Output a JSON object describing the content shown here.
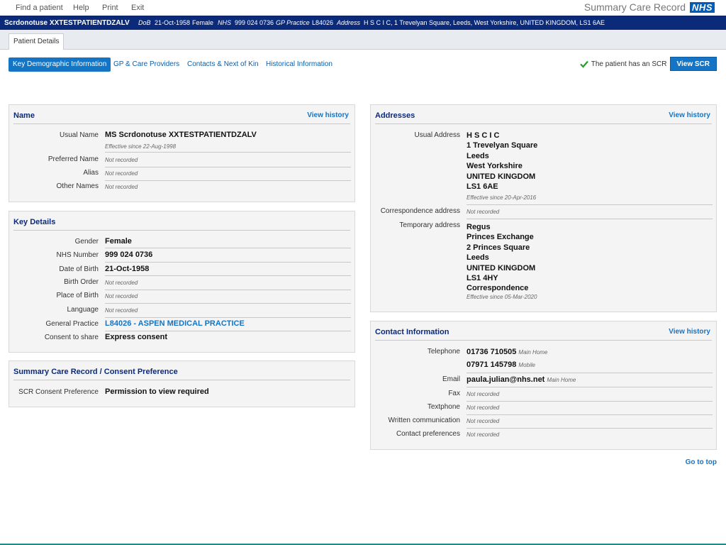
{
  "topnav": {
    "find_patient": "Find a patient",
    "help": "Help",
    "print": "Print",
    "exit": "Exit",
    "brand_title": "Summary Care Record",
    "nhs_logo": "NHS"
  },
  "banner": {
    "patient_name": "Scrdonotuse XXTESTPATIENTDZALV",
    "dob_label": "DoB",
    "dob": "21-Oct-1958",
    "gender": "Female",
    "nhs_label": "NHS",
    "nhs_number": "999 024 0736",
    "gp_label": "GP Practice",
    "gp_code": "L84026",
    "address_label": "Address",
    "address": "H S C I C, 1 Trevelyan Square, Leeds, West Yorkshire, UNITED KINGDOM, LS1 6AE"
  },
  "tabs": {
    "patient_details": "Patient Details"
  },
  "subnav": {
    "key_demographic": "Key Demographic Information",
    "gp_care": "GP & Care Providers",
    "contacts": "Contacts & Next of Kin",
    "historical": "Historical Information"
  },
  "scr": {
    "status_text": "The patient has an SCR",
    "view_button": "View SCR",
    "status_color": "#2a9a2a"
  },
  "name_panel": {
    "title": "Name",
    "view_history": "View history",
    "usual_name_label": "Usual Name",
    "usual_name": "MS Scrdonotuse XXTESTPATIENTDZALV",
    "usual_name_effective": "Effective since 22-Aug-1998",
    "preferred_name_label": "Preferred Name",
    "preferred_name": "Not recorded",
    "alias_label": "Alias",
    "alias": "Not recorded",
    "other_names_label": "Other Names",
    "other_names": "Not recorded"
  },
  "key_details": {
    "title": "Key Details",
    "gender_label": "Gender",
    "gender": "Female",
    "nhs_number_label": "NHS Number",
    "nhs_number": "999 024 0736",
    "dob_label": "Date of Birth",
    "dob": "21-Oct-1958",
    "birth_order_label": "Birth Order",
    "birth_order": "Not recorded",
    "place_of_birth_label": "Place of Birth",
    "place_of_birth": "Not recorded",
    "language_label": "Language",
    "language": "Not recorded",
    "gp_label": "General Practice",
    "gp": "L84026 - ASPEN MEDICAL PRACTICE",
    "consent_label": "Consent to share",
    "consent": "Express consent"
  },
  "consent_panel": {
    "title": "Summary Care Record / Consent Preference",
    "pref_label": "SCR Consent Preference",
    "pref": "Permission to view required"
  },
  "addresses": {
    "title": "Addresses",
    "view_history": "View history",
    "usual_label": "Usual Address",
    "usual_lines": [
      "H S C I C",
      "1 Trevelyan Square",
      "Leeds",
      "West Yorkshire",
      "UNITED KINGDOM",
      "LS1 6AE"
    ],
    "usual_effective": "Effective since 20-Apr-2016",
    "correspondence_label": "Correspondence address",
    "correspondence": "Not recorded",
    "temporary_label": "Temporary address",
    "temporary_lines": [
      "Regus",
      "Princes Exchange",
      "2 Princes Square",
      "Leeds",
      "UNITED KINGDOM",
      "LS1 4HY",
      "Correspondence"
    ],
    "temporary_effective": "Effective since 05-Mar-2020"
  },
  "contact": {
    "title": "Contact Information",
    "view_history": "View history",
    "telephone_label": "Telephone",
    "phone1": "01736 710505",
    "phone1_type": "Main Home",
    "phone2": "07971 145798",
    "phone2_type": "Mobile",
    "email_label": "Email",
    "email": "paula.julian@nhs.net",
    "email_type": "Main Home",
    "fax_label": "Fax",
    "fax": "Not recorded",
    "textphone_label": "Textphone",
    "textphone": "Not recorded",
    "written_label": "Written communication",
    "written": "Not recorded",
    "prefs_label": "Contact preferences",
    "prefs": "Not recorded"
  },
  "footer": {
    "go_to_top": "Go to top"
  }
}
